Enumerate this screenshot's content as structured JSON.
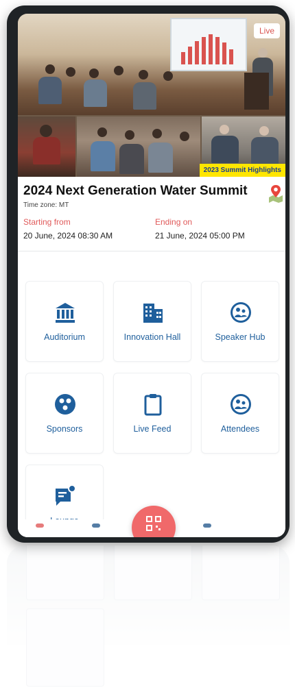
{
  "hero": {
    "live_label": "Live",
    "caption": "2023 Summit Highlights"
  },
  "event": {
    "title": "2024 Next Generation Water Summit",
    "timezone": "Time zone: MT",
    "start_label": "Starting from",
    "start_value": "20 June, 2024   08:30 AM",
    "end_label": "Ending on",
    "end_value": "21 June, 2024   05:00 PM"
  },
  "tiles": [
    {
      "label": "Auditorium",
      "icon": "building-columns-icon"
    },
    {
      "label": "Innovation Hall",
      "icon": "office-building-icon"
    },
    {
      "label": "Speaker Hub",
      "icon": "speaker-hub-icon"
    },
    {
      "label": "Sponsors",
      "icon": "sponsors-icon"
    },
    {
      "label": "Live Feed",
      "icon": "clipboard-icon"
    },
    {
      "label": "Attendees",
      "icon": "attendees-icon"
    },
    {
      "label": "Lounge",
      "icon": "chat-bubble-icon"
    }
  ],
  "colors": {
    "accent": "#1f5f9c",
    "live": "#d9534f",
    "caption_bg": "#ffe600",
    "fab": "#f0696a",
    "label_red": "#e05a5a"
  }
}
